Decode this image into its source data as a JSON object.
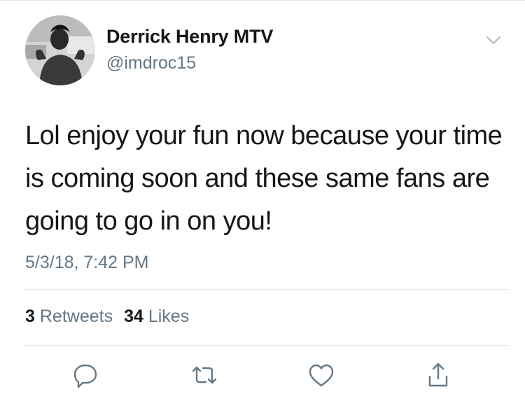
{
  "tweet": {
    "author": {
      "display_name": "Derrick Henry MTV",
      "handle": "@imdroc15"
    },
    "text": "Lol enjoy your fun now because your time is coming soon and these same fans are going to go in on you!",
    "timestamp": "5/3/18, 7:42 PM",
    "stats": {
      "retweets_count": "3",
      "retweets_label": "Retweets",
      "likes_count": "34",
      "likes_label": "Likes"
    }
  },
  "icons": {
    "menu": "chevron-down-icon",
    "reply": "reply-icon",
    "retweet": "retweet-icon",
    "like": "heart-icon",
    "share": "share-icon"
  },
  "colors": {
    "text_primary": "#14171a",
    "text_secondary": "#657786",
    "divider": "#e1e8ed"
  }
}
